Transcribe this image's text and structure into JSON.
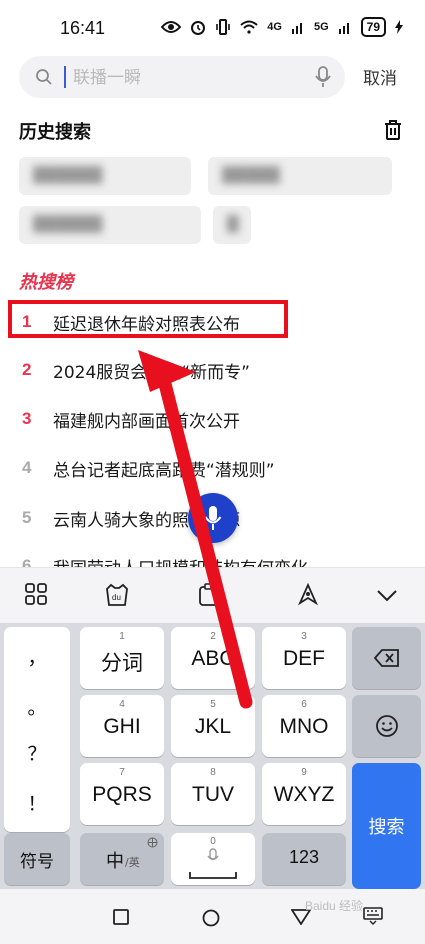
{
  "status_bar": {
    "time": "16:41",
    "signal_1": "4G",
    "signal_2": "5G",
    "battery": "79"
  },
  "search": {
    "placeholder": "联播一瞬",
    "cancel_label": "取消"
  },
  "history": {
    "title": "历史搜索",
    "items": [
      "██████",
      "█████",
      "██████",
      "█"
    ]
  },
  "hot": {
    "title": "热搜榜",
    "items": [
      {
        "rank": "1",
        "title": "延迟退休年龄对照表公布"
      },
      {
        "rank": "2",
        "title": "2024服贸会聚焦“新而专”"
      },
      {
        "rank": "3",
        "title": "福建舰内部画面首次公开"
      },
      {
        "rank": "4",
        "title": "总台记者起底高路费“潜规则”"
      },
      {
        "rank": "5",
        "title": "云南人骑大象的照片溯源"
      },
      {
        "rank": "6",
        "title": "我国劳动人口规模和结构有何变化"
      }
    ]
  },
  "keyboard": {
    "punctuation": [
      "，",
      "。",
      "？",
      "！"
    ],
    "rows": [
      [
        {
          "num": "1",
          "label": "分词"
        },
        {
          "num": "2",
          "label": "ABC"
        },
        {
          "num": "3",
          "label": "DEF"
        }
      ],
      [
        {
          "num": "4",
          "label": "GHI"
        },
        {
          "num": "5",
          "label": "JKL"
        },
        {
          "num": "6",
          "label": "MNO"
        }
      ],
      [
        {
          "num": "7",
          "label": "PQRS"
        },
        {
          "num": "8",
          "label": "TUV"
        },
        {
          "num": "9",
          "label": "WXYZ"
        }
      ]
    ],
    "symbols_label": "符号",
    "lang_label": "中",
    "lang_sub": "/英",
    "zero_label": "0",
    "num_label": "123",
    "search_label": "搜索"
  },
  "watermark": "Baidu 经验",
  "colors": {
    "accent_red": "#e8344d",
    "annotation_red": "#e8101e",
    "search_key_blue": "#3176f0",
    "voice_blue": "#1f40c8"
  }
}
